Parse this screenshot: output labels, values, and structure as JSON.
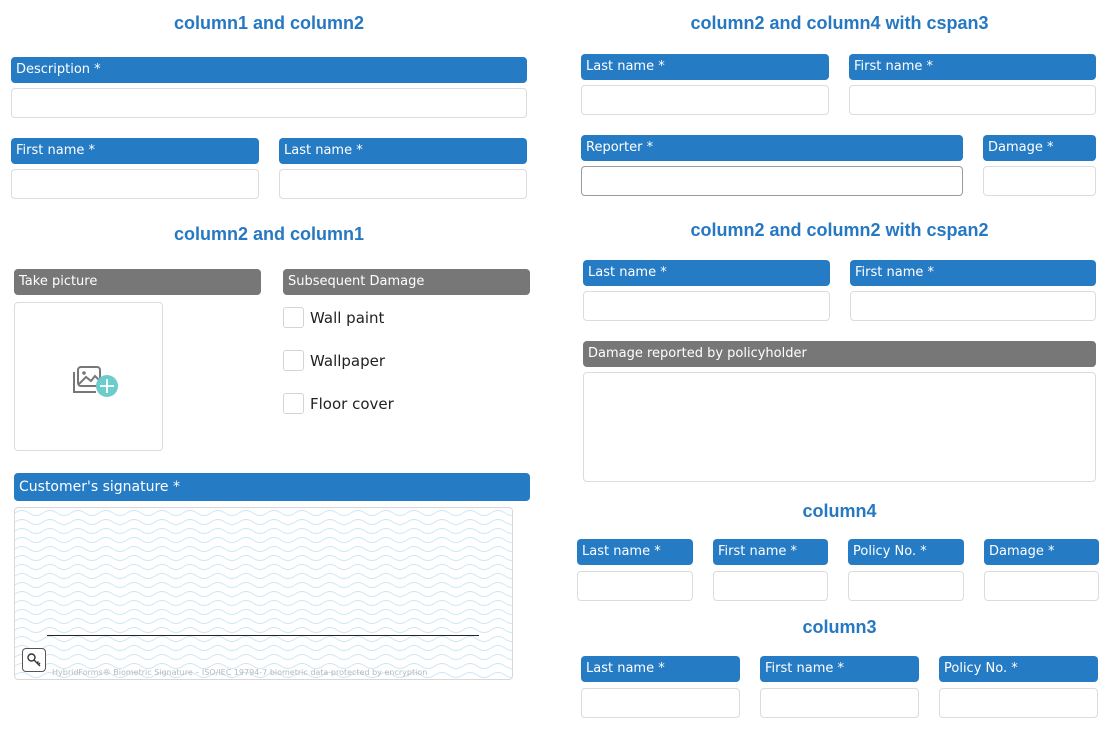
{
  "colors": {
    "heading": "#2678c2",
    "label_required": "#267bc5",
    "label_optional": "#777777",
    "photo_plus": "#6ccbcb"
  },
  "section1": {
    "heading": "column1 and column2",
    "description_label": "Description *",
    "first_name_label": "First name *",
    "last_name_label": "Last name *"
  },
  "section2": {
    "heading": "column2 and column1",
    "take_picture_label": "Take picture",
    "photo_icon": "add-image-icon",
    "subsequent_damage_label": "Subsequent Damage",
    "options": [
      "Wall paint",
      "Wallpaper",
      "Floor cover"
    ]
  },
  "signature": {
    "label": "Customer's signature *",
    "key_icon": "key-icon",
    "note": "HybridForms® Biometric Signature  –  ISO/IEC 19794-7 biometric data protected by encryption"
  },
  "section3": {
    "heading": "column2 and column4 with cspan3",
    "last_name_label": "Last name *",
    "first_name_label": "First name *",
    "reporter_label": "Reporter *",
    "damage_label": "Damage *"
  },
  "section4": {
    "heading": "column2 and column2 with cspan2",
    "last_name_label": "Last name *",
    "first_name_label": "First name *",
    "damage_reported_label": "Damage reported by policyholder"
  },
  "section5": {
    "heading": "column4",
    "labels": [
      "Last name *",
      "First name *",
      "Policy No. *",
      "Damage *"
    ]
  },
  "section6": {
    "heading": "column3",
    "labels": [
      "Last name *",
      "First name *",
      "Policy No. *"
    ]
  }
}
